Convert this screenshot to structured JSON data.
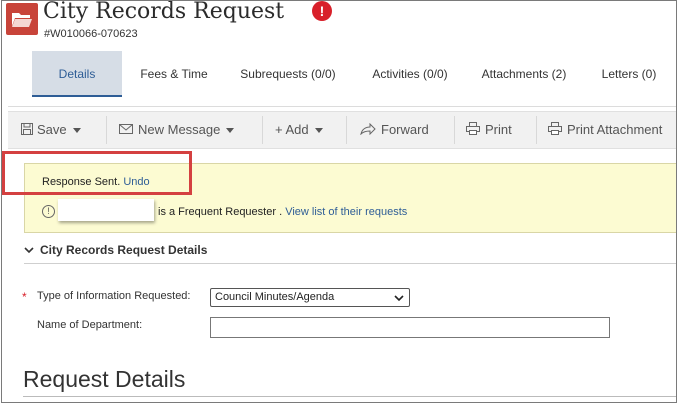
{
  "header": {
    "title": "City Records Request",
    "alert_symbol": "!",
    "record_id": "#W010066-070623"
  },
  "tabs": [
    {
      "label": "Details",
      "active": true
    },
    {
      "label": "Fees & Time"
    },
    {
      "label": "Subrequests (0/0)"
    },
    {
      "label": "Activities (0/0)"
    },
    {
      "label": "Attachments (2)"
    },
    {
      "label": "Letters (0)"
    }
  ],
  "toolbar": {
    "save": "Save",
    "new_message": "New Message",
    "add": "+ Add",
    "forward": "Forward",
    "print": "Print",
    "print_attachment": "Print Attachment"
  },
  "notice": {
    "response": "Response Sent.",
    "undo": "Undo",
    "info_icon": "!",
    "frequent_text": "is a Frequent Requester .",
    "view_link": "View list of their requests"
  },
  "section": {
    "title": "City Records Request Details"
  },
  "form": {
    "required_marker": "*",
    "type_label": "Type of Information Requested:",
    "type_value": "Council Minutes/Agenda",
    "department_label": "Name of Department:",
    "department_value": ""
  },
  "request_details_heading": "Request Details",
  "colors": {
    "accent": "#2e5d96",
    "alert": "#d8202a",
    "notice_bg": "#fcfbd2",
    "highlight": "#d44040"
  }
}
